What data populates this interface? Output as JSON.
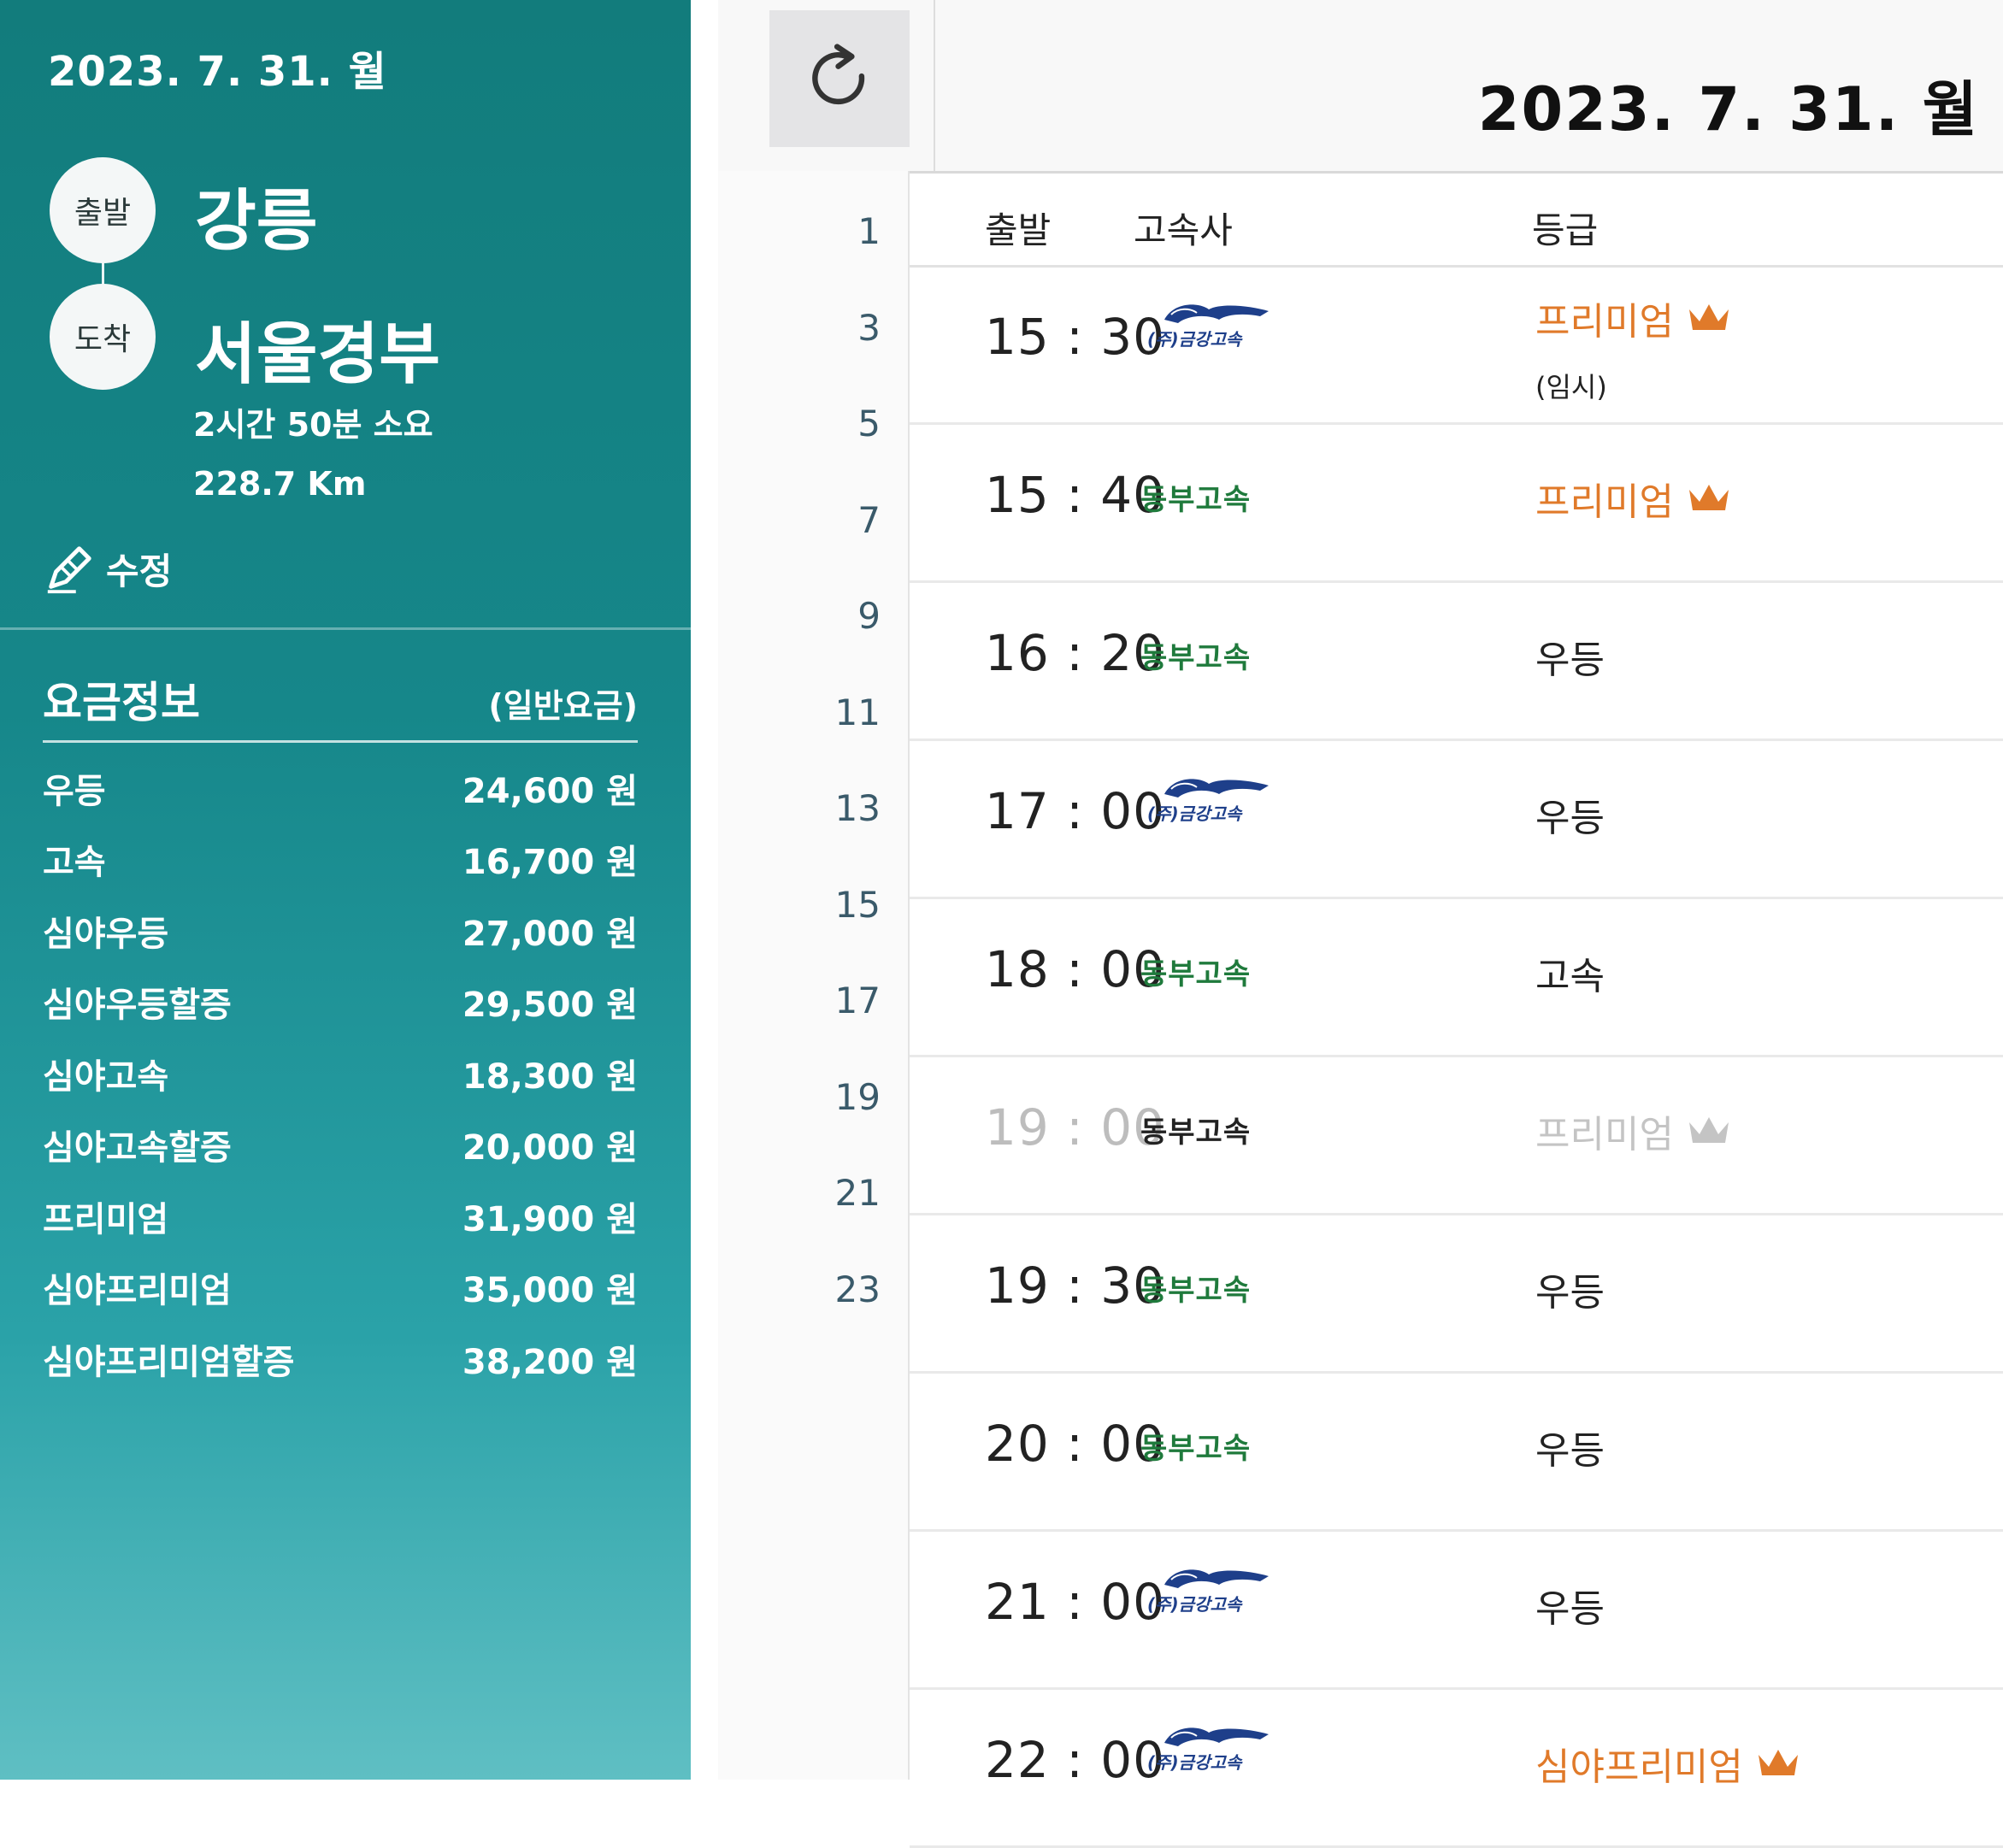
{
  "sidebar": {
    "date": "2023. 7. 31. 월",
    "departure_badge": "출발",
    "arrival_badge": "도착",
    "departure_city": "강릉",
    "arrival_city": "서울경부",
    "duration": "2시간 50분 소요",
    "distance": "228.7 Km",
    "edit_label": "수정",
    "fare_title": "요금정보",
    "fare_note": "(일반요금)",
    "fares": [
      {
        "grade": "우등",
        "price": "24,600 원"
      },
      {
        "grade": "고속",
        "price": "16,700 원"
      },
      {
        "grade": "심야우등",
        "price": "27,000 원"
      },
      {
        "grade": "심야우등할증",
        "price": "29,500 원"
      },
      {
        "grade": "심야고속",
        "price": "18,300 원"
      },
      {
        "grade": "심야고속할증",
        "price": "20,000 원"
      },
      {
        "grade": "프리미엄",
        "price": "31,900 원"
      },
      {
        "grade": "심야프리미엄",
        "price": "35,000 원"
      },
      {
        "grade": "심야프리미엄할증",
        "price": "38,200 원"
      }
    ]
  },
  "main": {
    "date": "2023. 7. 31. 월",
    "row_numbers": [
      "1",
      "3",
      "5",
      "7",
      "9",
      "11",
      "13",
      "15",
      "17",
      "19",
      "21",
      "23"
    ],
    "columns": {
      "departure": "출발",
      "company": "고속사",
      "grade": "등급"
    },
    "rows": [
      {
        "time": "15 : 30",
        "company": "(주)금강고속",
        "company_type": "geumgang",
        "grade": "프리미엄",
        "grade_note": "(임시)",
        "grade_style": "premium"
      },
      {
        "time": "15 : 40",
        "company": "동부고속",
        "company_type": "dongbu",
        "grade": "프리미엄",
        "grade_note": "",
        "grade_style": "premium"
      },
      {
        "time": "16 : 20",
        "company": "동부고속",
        "company_type": "dongbu",
        "grade": "우등",
        "grade_note": "",
        "grade_style": "normal"
      },
      {
        "time": "17 : 00",
        "company": "(주)금강고속",
        "company_type": "geumgang",
        "grade": "우등",
        "grade_note": "",
        "grade_style": "normal"
      },
      {
        "time": "18 : 00",
        "company": "동부고속",
        "company_type": "dongbu",
        "grade": "고속",
        "grade_note": "",
        "grade_style": "normal"
      },
      {
        "time": "19 : 00",
        "company": "동부고속",
        "company_type": "dongbu-dark",
        "grade": "프리미엄",
        "grade_note": "",
        "grade_style": "faded"
      },
      {
        "time": "19 : 30",
        "company": "동부고속",
        "company_type": "dongbu",
        "grade": "우등",
        "grade_note": "",
        "grade_style": "normal"
      },
      {
        "time": "20 : 00",
        "company": "동부고속",
        "company_type": "dongbu",
        "grade": "우등",
        "grade_note": "",
        "grade_style": "normal"
      },
      {
        "time": "21 : 00",
        "company": "(주)금강고속",
        "company_type": "geumgang",
        "grade": "우등",
        "grade_note": "",
        "grade_style": "normal"
      },
      {
        "time": "22 : 00",
        "company": "(주)금강고속",
        "company_type": "geumgang",
        "grade": "심야프리미엄",
        "grade_note": "",
        "grade_style": "premium"
      }
    ]
  },
  "icons": {
    "refresh": "refresh-icon",
    "edit": "edit-pen-icon",
    "premium": "crown-icon"
  },
  "colors": {
    "sidebar": "#16878a",
    "premium": "#e07a2a",
    "dongbu": "#1f7a3c",
    "geumgang": "#1e3f8a"
  }
}
